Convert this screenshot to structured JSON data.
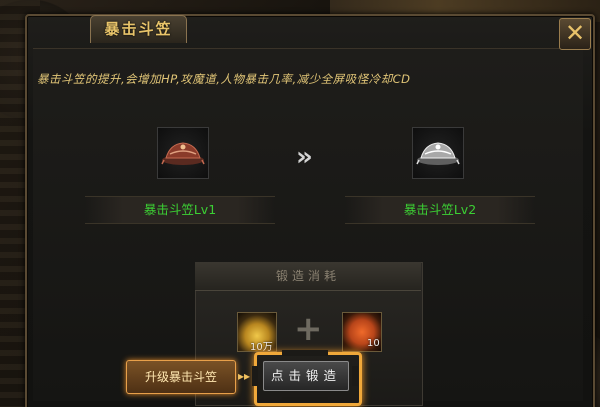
{
  "window": {
    "title": "暴击斗笠",
    "close_glyph": "✕"
  },
  "description": "暴击斗笠的提升,会增加HP,攻魔道,人物暴击几率,减少全屏吸怪冷却CD",
  "items": {
    "current": {
      "name": "暴击斗笠Lv1",
      "icon": "bronze-hat-icon"
    },
    "next": {
      "name": "暴击斗笠Lv2",
      "icon": "silver-hat-icon"
    },
    "arrow": "»"
  },
  "cost": {
    "title": "锻造消耗",
    "gold": {
      "icon": "gold-ingot-icon",
      "count": "10万"
    },
    "plus": "+",
    "stone": {
      "icon": "forge-stone-icon",
      "count": "10"
    }
  },
  "buttons": {
    "upgrade": "升级暴击斗笠",
    "forge": "点击锻造",
    "guide_arrow": "▸▸"
  },
  "colors": {
    "title": "#e8c46a",
    "item_name": "#3ccf34",
    "highlight": "#f0a83a"
  }
}
